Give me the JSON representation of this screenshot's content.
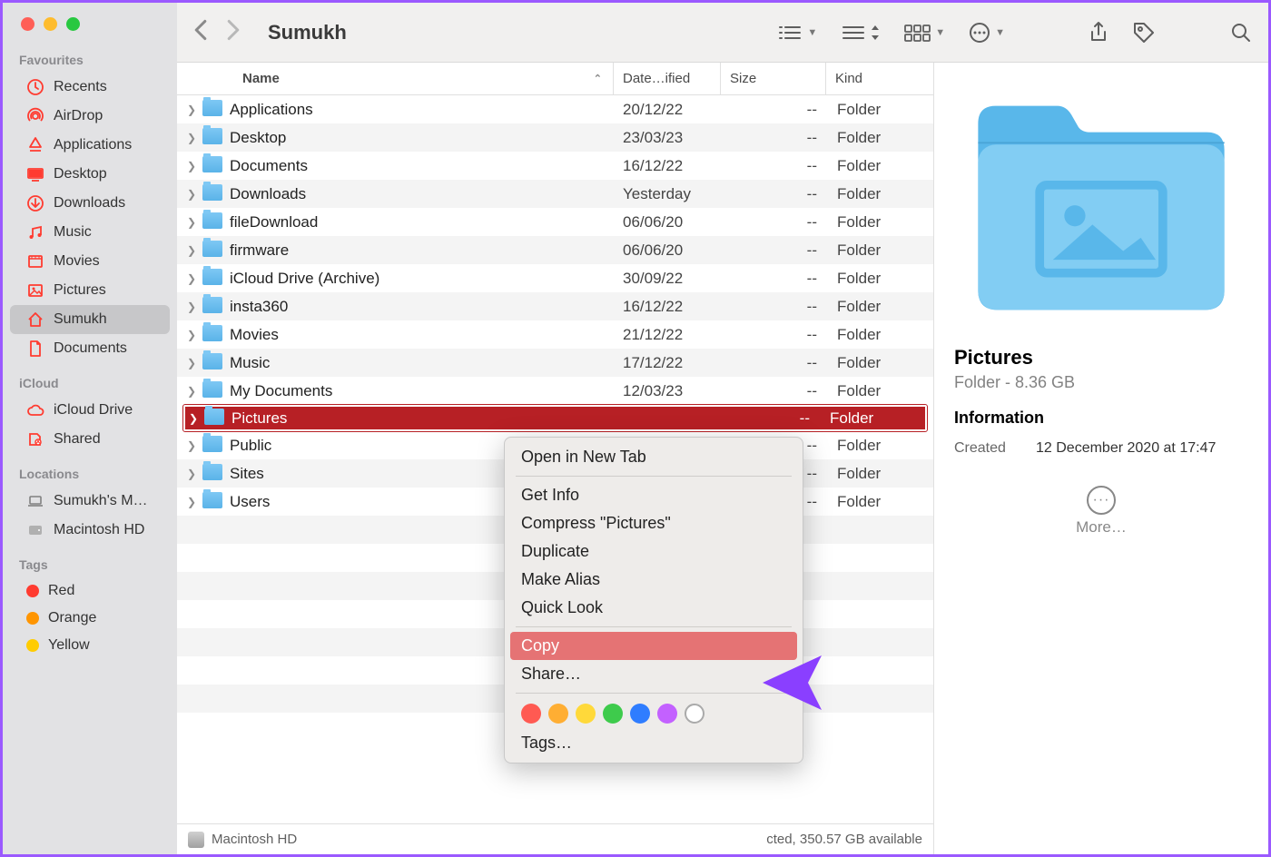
{
  "title": "Sumukh",
  "sidebar": {
    "favourites_heading": "Favourites",
    "favourites": [
      {
        "label": "Recents",
        "icon": "clock",
        "color": "#ff3b30"
      },
      {
        "label": "AirDrop",
        "icon": "airdrop",
        "color": "#ff3b30"
      },
      {
        "label": "Applications",
        "icon": "apps",
        "color": "#ff3b30"
      },
      {
        "label": "Desktop",
        "icon": "desktop",
        "color": "#ff3b30"
      },
      {
        "label": "Downloads",
        "icon": "downloads",
        "color": "#ff3b30"
      },
      {
        "label": "Music",
        "icon": "music",
        "color": "#ff3b30"
      },
      {
        "label": "Movies",
        "icon": "movies",
        "color": "#ff3b30"
      },
      {
        "label": "Pictures",
        "icon": "pictures",
        "color": "#ff3b30"
      },
      {
        "label": "Sumukh",
        "icon": "home",
        "color": "#ff3b30",
        "selected": true
      },
      {
        "label": "Documents",
        "icon": "doc",
        "color": "#ff3b30"
      }
    ],
    "icloud_heading": "iCloud",
    "icloud": [
      {
        "label": "iCloud Drive",
        "icon": "cloud"
      },
      {
        "label": "Shared",
        "icon": "shared"
      }
    ],
    "locations_heading": "Locations",
    "locations": [
      {
        "label": "Sumukh's M…",
        "icon": "laptop"
      },
      {
        "label": "Macintosh HD",
        "icon": "disk"
      }
    ],
    "tags_heading": "Tags",
    "tags": [
      {
        "label": "Red",
        "color": "#ff3b30"
      },
      {
        "label": "Orange",
        "color": "#ff9500"
      },
      {
        "label": "Yellow",
        "color": "#ffcc00"
      }
    ]
  },
  "columns": {
    "name": "Name",
    "date": "Date…ified",
    "size": "Size",
    "kind": "Kind"
  },
  "files": [
    {
      "name": "Applications",
      "date": "20/12/22",
      "size": "--",
      "kind": "Folder"
    },
    {
      "name": "Desktop",
      "date": "23/03/23",
      "size": "--",
      "kind": "Folder"
    },
    {
      "name": "Documents",
      "date": "16/12/22",
      "size": "--",
      "kind": "Folder"
    },
    {
      "name": "Downloads",
      "date": "Yesterday",
      "size": "--",
      "kind": "Folder"
    },
    {
      "name": "fileDownload",
      "date": "06/06/20",
      "size": "--",
      "kind": "Folder"
    },
    {
      "name": "firmware",
      "date": "06/06/20",
      "size": "--",
      "kind": "Folder"
    },
    {
      "name": "iCloud Drive (Archive)",
      "date": "30/09/22",
      "size": "--",
      "kind": "Folder"
    },
    {
      "name": "insta360",
      "date": "16/12/22",
      "size": "--",
      "kind": "Folder"
    },
    {
      "name": "Movies",
      "date": "21/12/22",
      "size": "--",
      "kind": "Folder"
    },
    {
      "name": "Music",
      "date": "17/12/22",
      "size": "--",
      "kind": "Folder"
    },
    {
      "name": "My Documents",
      "date": "12/03/23",
      "size": "--",
      "kind": "Folder"
    },
    {
      "name": "Pictures",
      "date": "",
      "size": "--",
      "kind": "Folder",
      "selected": true
    },
    {
      "name": "Public",
      "date": "",
      "size": "--",
      "kind": "Folder"
    },
    {
      "name": "Sites",
      "date": "",
      "size": "--",
      "kind": "Folder"
    },
    {
      "name": "Users",
      "date": "",
      "size": "--",
      "kind": "Folder"
    }
  ],
  "context_menu": {
    "items1": [
      "Open in New Tab"
    ],
    "items2": [
      "Get Info",
      "Compress \"Pictures\"",
      "Duplicate",
      "Make Alias",
      "Quick Look"
    ],
    "copy": "Copy",
    "share": "Share…",
    "tags": "Tags…",
    "tag_colors": [
      "#ff5a52",
      "#ffae33",
      "#ffd93a",
      "#3ecb4c",
      "#2f7dff",
      "#c361ff"
    ]
  },
  "preview": {
    "name": "Pictures",
    "sub": "Folder - 8.36 GB",
    "info": "Information",
    "created_k": "Created",
    "created_v": "12 December 2020 at 17:47",
    "more": "More…"
  },
  "status": {
    "path": "Macintosh HD",
    "right": "cted, 350.57 GB available"
  }
}
